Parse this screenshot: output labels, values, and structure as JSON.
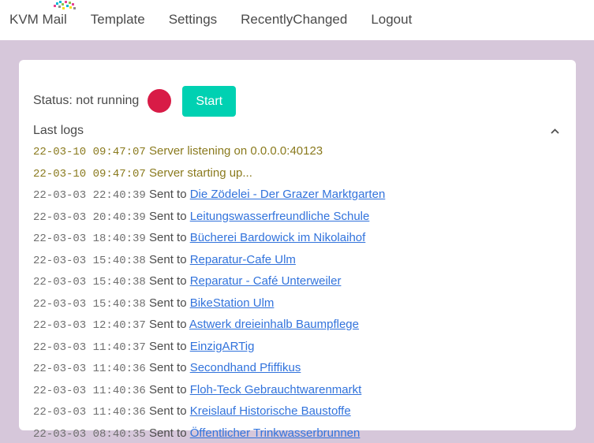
{
  "navbar": {
    "logo_name": "kvm-dots-logo",
    "links": [
      {
        "label": "KVM Mail"
      },
      {
        "label": "Template"
      },
      {
        "label": "Settings"
      },
      {
        "label": "RecentlyChanged"
      },
      {
        "label": "Logout"
      }
    ]
  },
  "card": {
    "status": {
      "label": "Status: not running",
      "indicator_color": "#d81b46",
      "start_label": "Start",
      "start_color": "#00d1b2"
    },
    "logs_title": "Last logs",
    "logs": [
      {
        "ts": "22-03-10 09:47:07",
        "msg": "Server listening on 0.0.0.0:40123",
        "target": "",
        "kind": "server"
      },
      {
        "ts": "22-03-10 09:47:07",
        "msg": "Server starting up...",
        "target": "",
        "kind": "server"
      },
      {
        "ts": "22-03-03 22:40:39",
        "msg": "Sent to ",
        "target": "Die Zödelei - Der Grazer Marktgarten",
        "kind": "sent"
      },
      {
        "ts": "22-03-03 20:40:39",
        "msg": "Sent to ",
        "target": "Leitungswasserfreundliche Schule",
        "kind": "sent"
      },
      {
        "ts": "22-03-03 18:40:39",
        "msg": "Sent to ",
        "target": "Bücherei Bardowick im Nikolaihof",
        "kind": "sent"
      },
      {
        "ts": "22-03-03 15:40:38",
        "msg": "Sent to ",
        "target": "Reparatur-Cafe Ulm",
        "kind": "sent"
      },
      {
        "ts": "22-03-03 15:40:38",
        "msg": "Sent to ",
        "target": "Reparatur - Café Unterweiler",
        "kind": "sent"
      },
      {
        "ts": "22-03-03 15:40:38",
        "msg": "Sent to ",
        "target": "BikeStation Ulm",
        "kind": "sent"
      },
      {
        "ts": "22-03-03 12:40:37",
        "msg": "Sent to ",
        "target": "Astwerk dreieinhalb Baumpflege",
        "kind": "sent"
      },
      {
        "ts": "22-03-03 11:40:37",
        "msg": "Sent to ",
        "target": "EinzigARTig",
        "kind": "sent"
      },
      {
        "ts": "22-03-03 11:40:36",
        "msg": "Sent to ",
        "target": "Secondhand Pfiffikus",
        "kind": "sent"
      },
      {
        "ts": "22-03-03 11:40:36",
        "msg": "Sent to ",
        "target": "Floh-Teck Gebrauchtwarenmarkt",
        "kind": "sent"
      },
      {
        "ts": "22-03-03 11:40:36",
        "msg": "Sent to ",
        "target": "Kreislauf Historische Baustoffe",
        "kind": "sent"
      },
      {
        "ts": "22-03-03 08:40:35",
        "msg": "Sent to ",
        "target": "Öffentlicher Trinkwasserbrunnen",
        "kind": "sent"
      }
    ],
    "scrollbar": {
      "up_arrow_glyph": "▲"
    }
  },
  "colors": {
    "page_background": "#d6c7da",
    "card_background": "#ffffff",
    "link": "#3273dc",
    "server_log": "#8a7a1e",
    "text": "#4a4a4a"
  }
}
